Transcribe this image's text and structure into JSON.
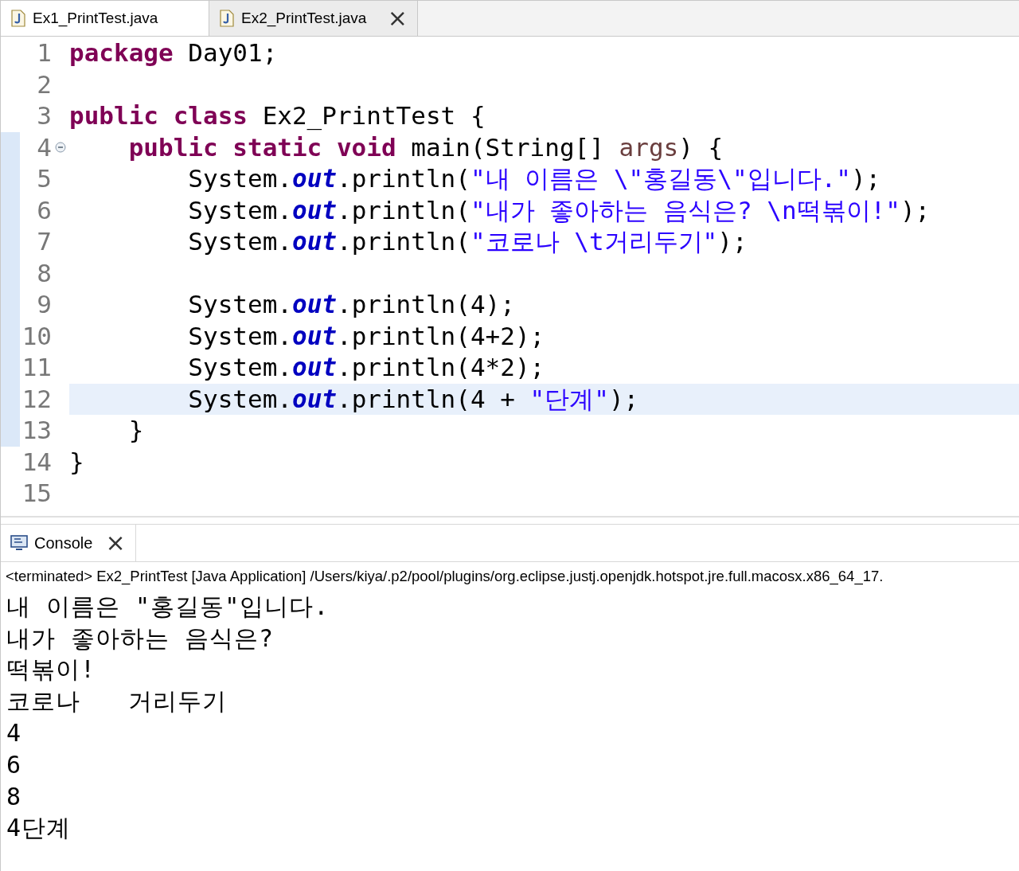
{
  "editor_tabs": [
    {
      "label": "Ex1_PrintTest.java",
      "selected": false,
      "closable": false
    },
    {
      "label": "Ex2_PrintTest.java",
      "selected": true,
      "closable": true
    }
  ],
  "close_glyph": "×",
  "editor": {
    "lines": [
      {
        "number": "1",
        "selected": false,
        "foldable": false,
        "in_range": false,
        "tokens": [
          {
            "kind": "keyword",
            "text": "package"
          },
          {
            "kind": "plain",
            "text": " Day01;"
          }
        ]
      },
      {
        "number": "2",
        "selected": false,
        "foldable": false,
        "in_range": false
      },
      {
        "number": "3",
        "selected": false,
        "foldable": false,
        "in_range": false,
        "tokens": [
          {
            "kind": "keyword",
            "text": "public class"
          },
          {
            "kind": "plain",
            "text": " Ex2_PrintTest {"
          }
        ]
      },
      {
        "number": "4",
        "selected": false,
        "foldable": true,
        "in_range": true,
        "tokens": [
          {
            "kind": "keyword",
            "text": "    public static void"
          },
          {
            "kind": "plain",
            "text": " main(String[] "
          },
          {
            "kind": "param",
            "text": "args"
          },
          {
            "kind": "plain",
            "text": ") {"
          }
        ]
      },
      {
        "number": "5",
        "selected": false,
        "foldable": false,
        "in_range": true,
        "tokens": [
          {
            "kind": "plain",
            "text": "        System."
          },
          {
            "kind": "field",
            "text": "out"
          },
          {
            "kind": "plain",
            "text": ".println("
          },
          {
            "kind": "string",
            "text": "\"내 이름은 \\\"홍길동\\\"입니다.\""
          },
          {
            "kind": "plain",
            "text": ");"
          }
        ]
      },
      {
        "number": "6",
        "selected": false,
        "foldable": false,
        "in_range": true,
        "tokens": [
          {
            "kind": "plain",
            "text": "        System."
          },
          {
            "kind": "field",
            "text": "out"
          },
          {
            "kind": "plain",
            "text": ".println("
          },
          {
            "kind": "string",
            "text": "\"내가 좋아하는 음식은? \\n떡볶이!\""
          },
          {
            "kind": "plain",
            "text": ");"
          }
        ]
      },
      {
        "number": "7",
        "selected": false,
        "foldable": false,
        "in_range": true,
        "tokens": [
          {
            "kind": "plain",
            "text": "        System."
          },
          {
            "kind": "field",
            "text": "out"
          },
          {
            "kind": "plain",
            "text": ".println("
          },
          {
            "kind": "string",
            "text": "\"코로나 \\t거리두기\""
          },
          {
            "kind": "plain",
            "text": ");"
          }
        ]
      },
      {
        "number": "8",
        "selected": false,
        "foldable": false,
        "in_range": true
      },
      {
        "number": "9",
        "selected": false,
        "foldable": false,
        "in_range": true,
        "tokens": [
          {
            "kind": "plain",
            "text": "        System."
          },
          {
            "kind": "field",
            "text": "out"
          },
          {
            "kind": "plain",
            "text": ".println(4);"
          }
        ]
      },
      {
        "number": "10",
        "selected": false,
        "foldable": false,
        "in_range": true,
        "tokens": [
          {
            "kind": "plain",
            "text": "        System."
          },
          {
            "kind": "field",
            "text": "out"
          },
          {
            "kind": "plain",
            "text": ".println(4+2);"
          }
        ]
      },
      {
        "number": "11",
        "selected": false,
        "foldable": false,
        "in_range": true,
        "tokens": [
          {
            "kind": "plain",
            "text": "        System."
          },
          {
            "kind": "field",
            "text": "out"
          },
          {
            "kind": "plain",
            "text": ".println(4*2);"
          }
        ]
      },
      {
        "number": "12",
        "selected": true,
        "foldable": false,
        "in_range": true,
        "tokens": [
          {
            "kind": "plain",
            "text": "        System."
          },
          {
            "kind": "field",
            "text": "out"
          },
          {
            "kind": "plain",
            "text": ".println(4 + "
          },
          {
            "kind": "string",
            "text": "\"단계\""
          },
          {
            "kind": "plain",
            "text": ");"
          }
        ]
      },
      {
        "number": "13",
        "selected": false,
        "foldable": false,
        "in_range": true,
        "tokens": [
          {
            "kind": "plain",
            "text": "    }"
          }
        ]
      },
      {
        "number": "14",
        "selected": false,
        "foldable": false,
        "in_range": false,
        "tokens": [
          {
            "kind": "plain",
            "text": "}"
          }
        ]
      },
      {
        "number": "15",
        "selected": false,
        "foldable": false,
        "in_range": false
      }
    ]
  },
  "console": {
    "tab": {
      "label": "Console",
      "selected": true
    },
    "status": "<terminated> Ex2_PrintTest [Java Application] /Users/kiya/.p2/pool/plugins/org.eclipse.justj.openjdk.hotspot.jre.full.macosx.x86_64_17.",
    "output": [
      "내 이름은 \"홍길동\"입니다.",
      "내가 좋아하는 음식은?",
      "떡볶이!",
      "코로나\t거리두기",
      "4",
      "6",
      "8",
      "4단계"
    ]
  }
}
